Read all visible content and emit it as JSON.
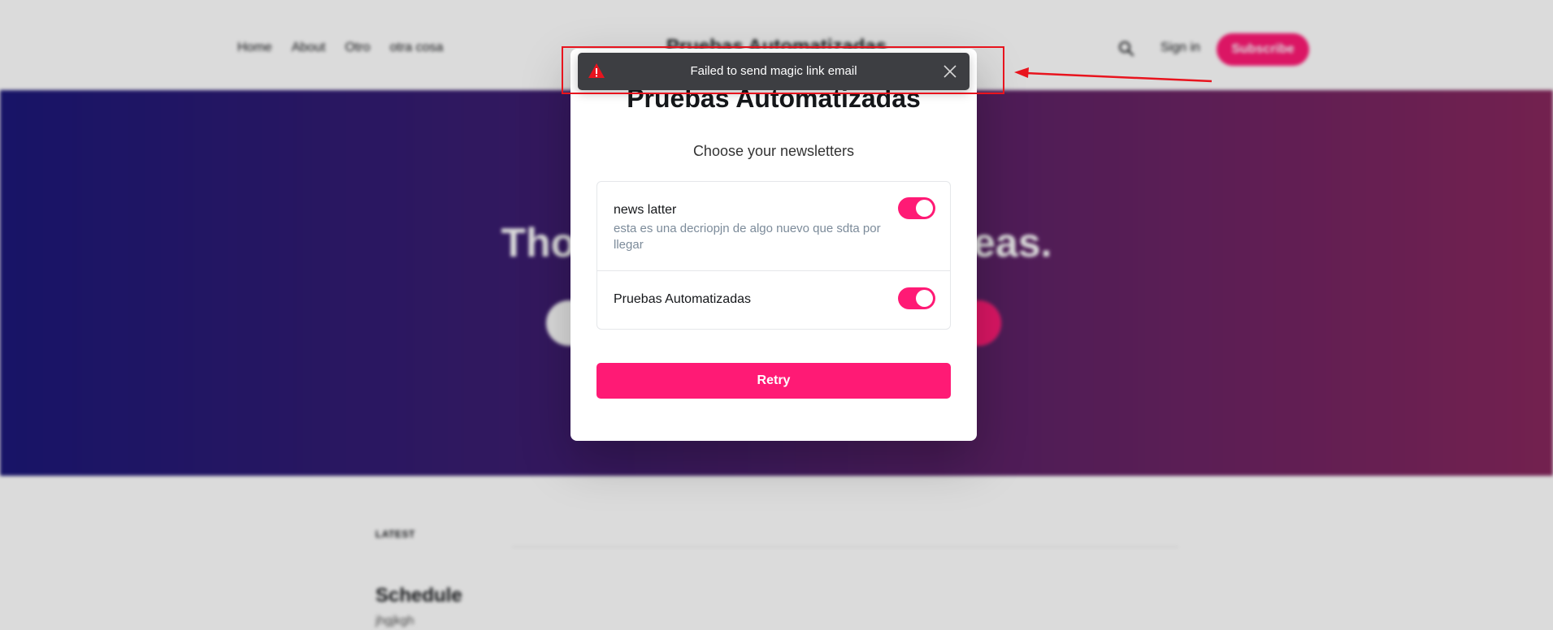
{
  "site": {
    "nav": [
      "Home",
      "About",
      "Otro",
      "otra cosa"
    ],
    "title": "Pruebas Automatizadas",
    "signin_label": "Sign in",
    "subscribe_label": "Subscribe",
    "hero_text": "Thoughts, stories and ideas.",
    "latest_label": "LATEST",
    "post_title": "Schedule",
    "post_excerpt": "jhgjkgh"
  },
  "modal": {
    "title": "Pruebas Automatizadas",
    "subtitle": "Choose your newsletters",
    "newsletters": [
      {
        "name": "news latter",
        "description": "esta es una decriopjn de algo nuevo que sdta por llegar",
        "enabled": true
      },
      {
        "name": "Pruebas Automatizadas",
        "description": "",
        "enabled": true
      }
    ],
    "retry_label": "Retry"
  },
  "toast": {
    "message": "Failed to send magic link email",
    "icon": "warning-icon"
  },
  "colors": {
    "accent": "#ff1a75",
    "toast_bg": "#3d3e42",
    "annotation": "#e8141e",
    "hero_start": "#1c1878",
    "hero_end": "#86275d"
  }
}
